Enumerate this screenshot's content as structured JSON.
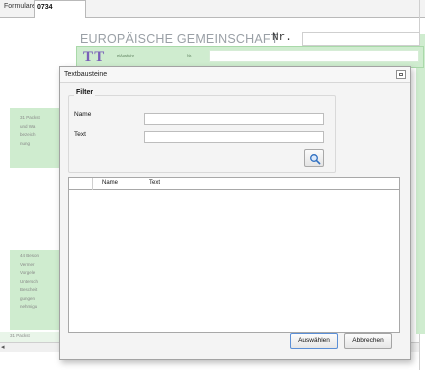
{
  "window": {
    "tab_label": "Formulare",
    "tab_number": "0734"
  },
  "form": {
    "title": "EUROPÄISCHE GEMEINSCHAFT",
    "nr_label": "Nr.",
    "green_small_left": "eiAusfuhr",
    "green_small_right": "Nr.",
    "left_section_1": [
      "31 Packst",
      "und Wa",
      "bezeich",
      "nung"
    ],
    "left_section_2": [
      "44 Beson",
      "Vermer",
      "Vorgele",
      "Untersch",
      "Bescheit",
      "gungen",
      "nehmigu"
    ],
    "bottom_left": "31 Packst"
  },
  "dialog": {
    "title": "Textbausteine",
    "filter": {
      "legend": "Filter",
      "name_label": "Name",
      "text_label": "Text",
      "name_value": "",
      "text_value": ""
    },
    "list": {
      "columns": [
        "Name",
        "Text"
      ],
      "rows": []
    },
    "buttons": {
      "select": "Auswählen",
      "cancel": "Abbrechen"
    }
  },
  "icons": {
    "search": "search-icon",
    "maximize": "maximize-icon",
    "text_template": "text-template-icon",
    "scroll_left": "scroll-left-arrow-icon"
  },
  "colors": {
    "form_green": "#cfeccf",
    "title_gray": "#9aa0a6",
    "icon_purple": "#7a5fb8",
    "primary_button_border": "#5b8fd6"
  }
}
